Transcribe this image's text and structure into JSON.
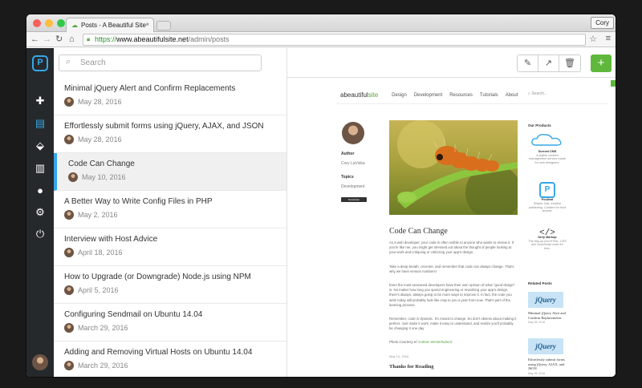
{
  "browser": {
    "tab_title": "Posts - A Beautiful Site",
    "user_label": "Cory",
    "url_scheme": "https://",
    "url_host": "www.abeautifulsite.net",
    "url_path": "/admin/posts"
  },
  "search": {
    "placeholder": "Search"
  },
  "posts": [
    {
      "title": "Minimal jQuery Alert and Confirm Replacements",
      "date": "May 28, 2016"
    },
    {
      "title": "Effortlessly submit forms using jQuery, AJAX, and JSON",
      "date": "May 28, 2016"
    },
    {
      "title": "Code Can Change",
      "date": "May 10, 2016",
      "selected": true
    },
    {
      "title": "A Better Way to Write Config Files in PHP",
      "date": "May 2, 2016"
    },
    {
      "title": "Interview with Host Advice",
      "date": "April 18, 2016"
    },
    {
      "title": "How to Upgrade (or Downgrade) Node.js using NPM",
      "date": "April 5, 2016"
    },
    {
      "title": "Configuring Sendmail on Ubuntu 14.04",
      "date": "March 29, 2016"
    },
    {
      "title": "Adding and Removing Virtual Hosts on Ubuntu 14.04",
      "date": "March 29, 2016"
    }
  ],
  "preview": {
    "brand_prefix": "abeautiful",
    "brand_suffix": "site",
    "nav": [
      "Design",
      "Development",
      "Resources",
      "Tutorials",
      "About"
    ],
    "search_placeholder": "Search...",
    "author_label": "Author",
    "author_name": "Cory LaViska",
    "topics_label": "Topics",
    "topic": "Development",
    "newsletter_label": "Newsletter",
    "article_title": "Code Can Change",
    "paragraphs": [
      "As a web developer, your code is often visible to anyone who wants to review it. If you're like me, you might get stressed out about the thought of people looking at your work and critiquing or criticizing your app's design.",
      "Take a deep breath, recenter, and remember that code can always change. That's why we have version numbers!",
      "Even the most seasoned developers have their own opinion of what \"good design\" is. No matter how long you spend engineering or reworking your app's design, there's always, always going to be more ways to improve it. In fact, the code you write today will probably look like crap to you a year from now. That's part of the learning process.",
      "Remember, code is dynamic. It's meant to change. So don't obsess about making it perfect. Just make it work, make it easy to understand, and realize you'll probably be changing it one day."
    ],
    "photo_credit_prefix": "Photo Courtesy of",
    "photo_credit_name": "Andrew Westerhuberd",
    "article_date": "May 10, 2016",
    "next_title": "Thanks for Reading",
    "products_heading": "Our Products",
    "products": [
      {
        "name": "Surreal CMS",
        "desc": "A stylish content management service made for web designers."
      },
      {
        "name": "Postleaf",
        "desc": "Simple, fast, intuitive publishing. Curated for bold access."
      },
      {
        "name": "Dirty Markup",
        "desc": "The tidy-up tool HTML, CSS and JavaScript code for free."
      }
    ],
    "related_heading": "Related Posts",
    "related": [
      {
        "logo": "jQuery",
        "title": "Minimal jQuery Alert and Confirm Replacements",
        "date": "May 28, 2016"
      },
      {
        "logo": "jQuery",
        "title": "Effortlessly submit forms using jQuery, AJAX, and JSON",
        "date": "May 28, 2016"
      }
    ]
  },
  "colors": {
    "accent": "#35a7e8",
    "add_button": "#5fb83c",
    "rail": "#26292c",
    "brand_green": "#58a43b"
  },
  "icons": {
    "rail": [
      "logo-icon",
      "plus-icon",
      "document-icon",
      "tag-icon",
      "map-icon",
      "user-icon",
      "gear-icon",
      "power-icon"
    ],
    "toolbar": [
      "pencil-icon",
      "external-link-icon",
      "trash-icon",
      "plus-icon"
    ]
  }
}
